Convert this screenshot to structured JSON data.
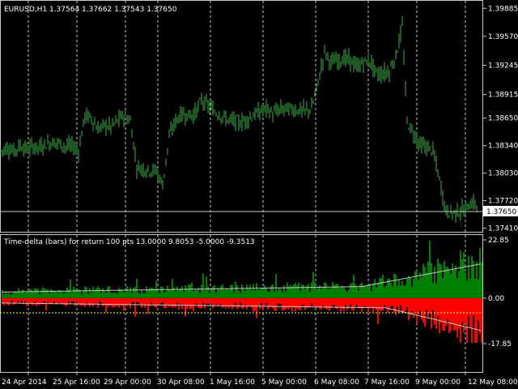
{
  "window": {
    "symbol_info": "EURUSD,H1  1.37564 1.37662 1.37543 1.37650"
  },
  "colors": {
    "background": "#000000",
    "candle": "#3cb043",
    "grid": "#c8c8c8",
    "frame": "#c8c8c8",
    "text": "#ffffff",
    "histogram_up": "#008000",
    "histogram_down": "#ff0000",
    "average_line": "#c8c8c8",
    "zero_line": "#ffff00",
    "price_label_bg": "#ffffff",
    "price_label_text": "#000000"
  },
  "chart_data": [
    {
      "type": "candlestick",
      "title": "EURUSD,H1",
      "ohlc": {
        "open": 1.37564,
        "high": 1.37662,
        "low": 1.37543,
        "close": 1.3765
      },
      "current_price": "1.37650",
      "y_ticks": [
        "1.39885",
        "1.39570",
        "1.39245",
        "1.38915",
        "1.38650",
        "1.38340",
        "1.38030",
        "1.37720",
        "1.37410"
      ],
      "ylim": [
        1.3737,
        1.3997
      ],
      "grid": "vertical-dashed",
      "series_close": [
        [
          0,
          1.3828
        ],
        [
          8,
          1.3832
        ],
        [
          16,
          1.3828
        ],
        [
          24,
          1.3834
        ],
        [
          32,
          1.383
        ],
        [
          40,
          1.3833
        ],
        [
          48,
          1.3832
        ],
        [
          56,
          1.3836
        ],
        [
          64,
          1.3838
        ],
        [
          72,
          1.3837
        ],
        [
          80,
          1.3833
        ],
        [
          88,
          1.3834
        ],
        [
          96,
          1.3828
        ],
        [
          104,
          1.3868
        ],
        [
          112,
          1.3865
        ],
        [
          120,
          1.3852
        ],
        [
          128,
          1.3857
        ],
        [
          136,
          1.3855
        ],
        [
          144,
          1.3862
        ],
        [
          152,
          1.3868
        ],
        [
          160,
          1.3862
        ],
        [
          168,
          1.381
        ],
        [
          176,
          1.3808
        ],
        [
          184,
          1.3806
        ],
        [
          192,
          1.3806
        ],
        [
          200,
          1.379
        ],
        [
          208,
          1.3844
        ],
        [
          216,
          1.3862
        ],
        [
          224,
          1.387
        ],
        [
          232,
          1.3868
        ],
        [
          240,
          1.387
        ],
        [
          248,
          1.3885
        ],
        [
          256,
          1.3879
        ],
        [
          264,
          1.3872
        ],
        [
          272,
          1.3868
        ],
        [
          280,
          1.3863
        ],
        [
          288,
          1.3862
        ],
        [
          296,
          1.386
        ],
        [
          304,
          1.3864
        ],
        [
          312,
          1.3868
        ],
        [
          320,
          1.3872
        ],
        [
          328,
          1.3876
        ],
        [
          336,
          1.387
        ],
        [
          344,
          1.3874
        ],
        [
          352,
          1.3876
        ],
        [
          360,
          1.3875
        ],
        [
          368,
          1.3874
        ],
        [
          376,
          1.3873
        ],
        [
          384,
          1.3876
        ],
        [
          392,
          1.3905
        ],
        [
          400,
          1.394
        ],
        [
          408,
          1.3928
        ],
        [
          416,
          1.393
        ],
        [
          424,
          1.3932
        ],
        [
          432,
          1.393
        ],
        [
          440,
          1.3922
        ],
        [
          448,
          1.3928
        ],
        [
          456,
          1.393
        ],
        [
          464,
          1.3915
        ],
        [
          472,
          1.3915
        ],
        [
          480,
          1.3918
        ],
        [
          488,
          1.3935
        ],
        [
          496,
          1.3968
        ],
        [
          502,
          1.386
        ],
        [
          510,
          1.3848
        ],
        [
          518,
          1.3835
        ],
        [
          526,
          1.3832
        ],
        [
          534,
          1.3828
        ],
        [
          542,
          1.3795
        ],
        [
          550,
          1.376
        ],
        [
          558,
          1.3758
        ],
        [
          566,
          1.376
        ],
        [
          574,
          1.3762
        ],
        [
          582,
          1.377
        ],
        [
          590,
          1.3765
        ]
      ]
    },
    {
      "type": "bar",
      "title": "Time-delta (bars) for return 100 pts 13.0000 9.8053 -5.0000 -9.3513",
      "y_ticks": [
        "22.85",
        "0.00",
        "-17.85"
      ],
      "ylim": [
        -17.85,
        22.85
      ],
      "zero_line": true,
      "series": [
        {
          "name": "",
          "type": "positive-histogram"
        },
        {
          "name": "",
          "type": "negative-histogram"
        },
        {
          "name": "",
          "type": "average-line"
        }
      ]
    }
  ],
  "x_axis": {
    "labels": [
      "24 Apr 2014",
      "25 Apr 16:00",
      "29 Apr 00:00",
      "30 Apr 08:00",
      "1 May 16:00",
      "5 May 00:00",
      "6 May 08:00",
      "7 May 16:00",
      "9 May 00:00",
      "12 May 08:00"
    ]
  }
}
